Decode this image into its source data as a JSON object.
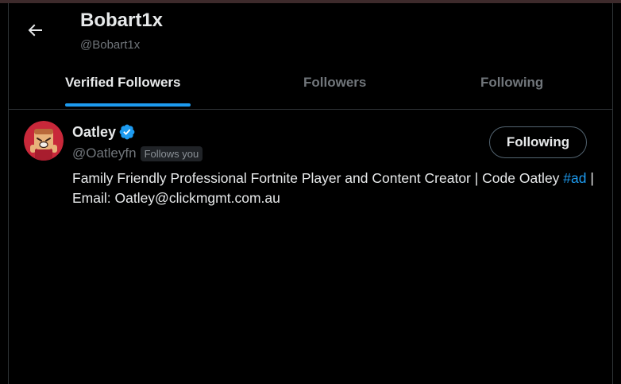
{
  "header": {
    "title": "Bobart1x",
    "handle": "@Bobart1x"
  },
  "tabs": [
    {
      "label": "Verified Followers",
      "active": true
    },
    {
      "label": "Followers",
      "active": false
    },
    {
      "label": "Following",
      "active": false
    }
  ],
  "user": {
    "name": "Oatley",
    "handle": "@Oatleyfn",
    "follows_you": "Follows you",
    "button_label": "Following",
    "bio_text_1": "Family Friendly Professional Fortnite Player and Content Creator | Code Oatley ",
    "bio_hashtag": "#ad",
    "bio_text_2": " | Email: Oatley@clickmgmt.com.au"
  },
  "icons": {
    "back": "arrow-left-icon",
    "verified": "verified-badge-icon"
  },
  "colors": {
    "accent": "#1d9bf0",
    "background": "#000000",
    "text_primary": "#e7e9ea",
    "text_secondary": "#71767b"
  }
}
